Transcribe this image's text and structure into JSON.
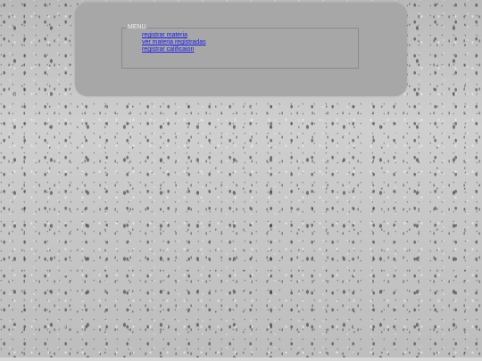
{
  "menu": {
    "legend": "MENU",
    "items": [
      {
        "label": "registrar materia"
      },
      {
        "label": "ver materia registradas"
      },
      {
        "label": "registrar calificaion"
      }
    ]
  }
}
